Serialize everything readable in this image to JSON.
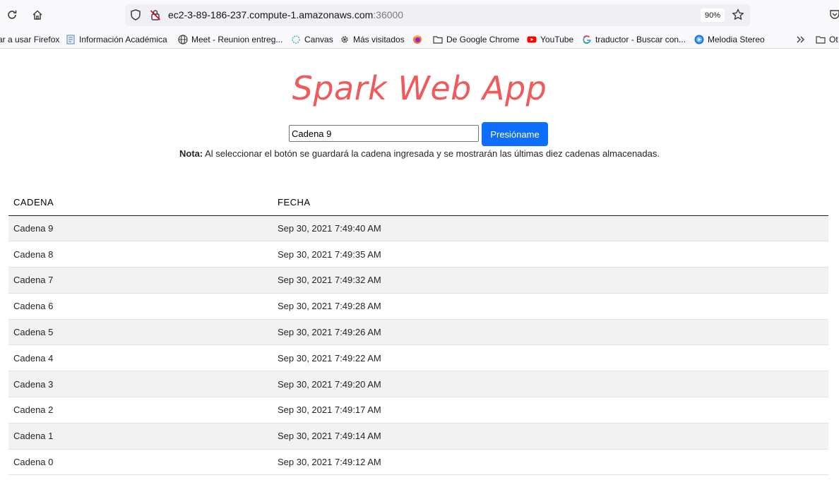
{
  "browser": {
    "url_host": "ec2-3-89-186-237.compute-1.amazonaws.com",
    "url_port": ":36000",
    "zoom": "90%",
    "bookmarks": [
      {
        "label": "ar a usar Firefox",
        "icon": "none"
      },
      {
        "label": "Información Académica",
        "icon": "document-icon"
      },
      {
        "label": "Meet - Reunion entreg...",
        "icon": "globe-icon"
      },
      {
        "label": "Canvas",
        "icon": "canvas-icon"
      },
      {
        "label": "Más visitados",
        "icon": "gear-icon"
      },
      {
        "label": "",
        "icon": "firefox-icon"
      },
      {
        "label": "De Google Chrome",
        "icon": "folder-icon"
      },
      {
        "label": "YouTube",
        "icon": "youtube-icon"
      },
      {
        "label": "traductor - Buscar con...",
        "icon": "google-icon"
      },
      {
        "label": "Melodia Stereo",
        "icon": "play-icon"
      },
      {
        "label": "Ot",
        "icon": "folder-icon"
      }
    ]
  },
  "app": {
    "title": "Spark Web App",
    "input_value": "Cadena 9",
    "button_label": "Presióname",
    "note_label": "Nota:",
    "note_text": " Al seleccionar el botón se guardará la cadena ingresada y se mostrarán las últimas diez cadenas almacenadas."
  },
  "table": {
    "headers": [
      "CADENA",
      "FECHA"
    ],
    "rows": [
      [
        "Cadena 9",
        "Sep 30, 2021 7:49:40 AM"
      ],
      [
        "Cadena 8",
        "Sep 30, 2021 7:49:35 AM"
      ],
      [
        "Cadena 7",
        "Sep 30, 2021 7:49:32 AM"
      ],
      [
        "Cadena 6",
        "Sep 30, 2021 7:49:28 AM"
      ],
      [
        "Cadena 5",
        "Sep 30, 2021 7:49:26 AM"
      ],
      [
        "Cadena 4",
        "Sep 30, 2021 7:49:22 AM"
      ],
      [
        "Cadena 3",
        "Sep 30, 2021 7:49:20 AM"
      ],
      [
        "Cadena 2",
        "Sep 30, 2021 7:49:17 AM"
      ],
      [
        "Cadena 1",
        "Sep 30, 2021 7:49:14 AM"
      ],
      [
        "Cadena 0",
        "Sep 30, 2021 7:49:12 AM"
      ]
    ]
  },
  "colors": {
    "title": "#f05a5a",
    "button": "#0d6efd",
    "stripe": "#f2f2f2"
  }
}
